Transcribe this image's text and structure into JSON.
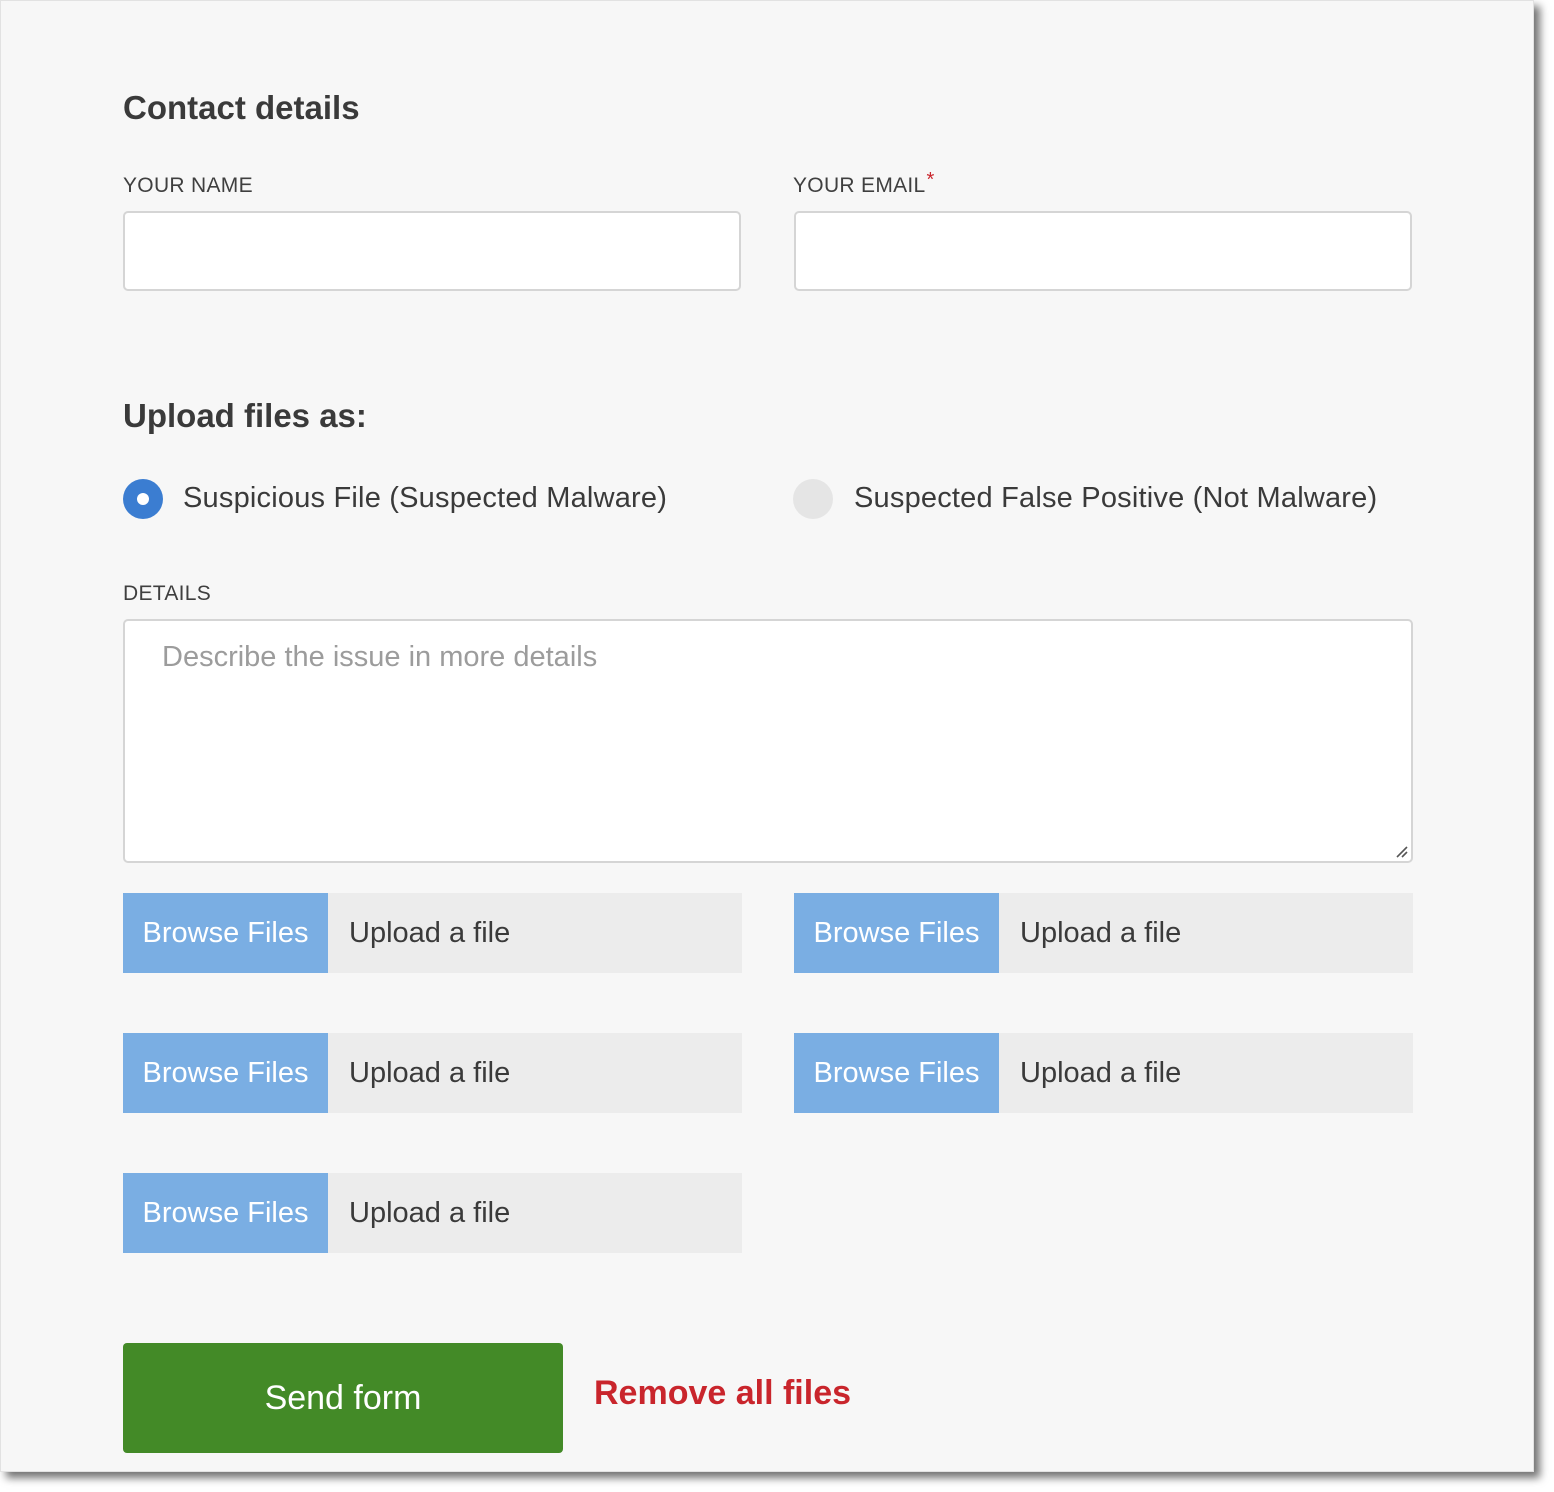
{
  "contact": {
    "title": "Contact details",
    "name_label": "YOUR NAME",
    "name_value": "",
    "email_label": "YOUR EMAIL",
    "email_required_mark": "*",
    "email_value": ""
  },
  "upload_type": {
    "title": "Upload files as:",
    "options": [
      {
        "label": "Suspicious File (Suspected Malware)",
        "selected": true
      },
      {
        "label": "Suspected False Positive (Not Malware)",
        "selected": false
      }
    ]
  },
  "details": {
    "label": "DETAILS",
    "placeholder": "Describe the issue in more details",
    "value": ""
  },
  "uploads": [
    {
      "button": "Browse Files",
      "text": "Upload a file"
    },
    {
      "button": "Browse Files",
      "text": "Upload a file"
    },
    {
      "button": "Browse Files",
      "text": "Upload a file"
    },
    {
      "button": "Browse Files",
      "text": "Upload a file"
    },
    {
      "button": "Browse Files",
      "text": "Upload a file"
    }
  ],
  "actions": {
    "send_label": "Send form",
    "remove_label": "Remove all files"
  },
  "colors": {
    "primary_radio": "#3b7dd1",
    "browse_button": "#7aaee3",
    "send_button": "#438a27",
    "remove_link": "#c9252c",
    "required_mark": "#c9252c"
  },
  "icons": {
    "radio_checked": "radio-checked-icon",
    "radio_unchecked": "radio-unchecked-icon",
    "resize": "resize-handle-icon"
  }
}
